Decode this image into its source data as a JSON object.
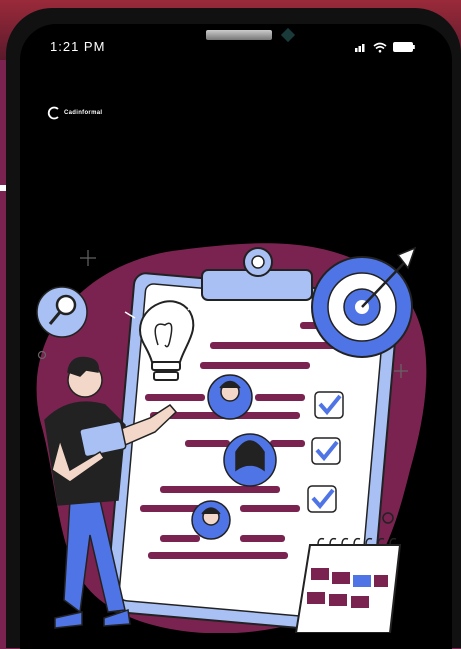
{
  "status_bar": {
    "time": "1:21 PM"
  },
  "brand": {
    "logo_text": "Cadinformal"
  },
  "colors": {
    "accent_purple": "#7a2350",
    "accent_blue": "#4f74e6",
    "light_blue": "#a9c0f5",
    "background": "#000000"
  },
  "icons": [
    "signal-icon",
    "wifi-icon",
    "battery-icon",
    "logo-icon",
    "magnifier-icon",
    "target-icon",
    "lightbulb-icon",
    "calendar-icon",
    "checkmark-icon"
  ]
}
